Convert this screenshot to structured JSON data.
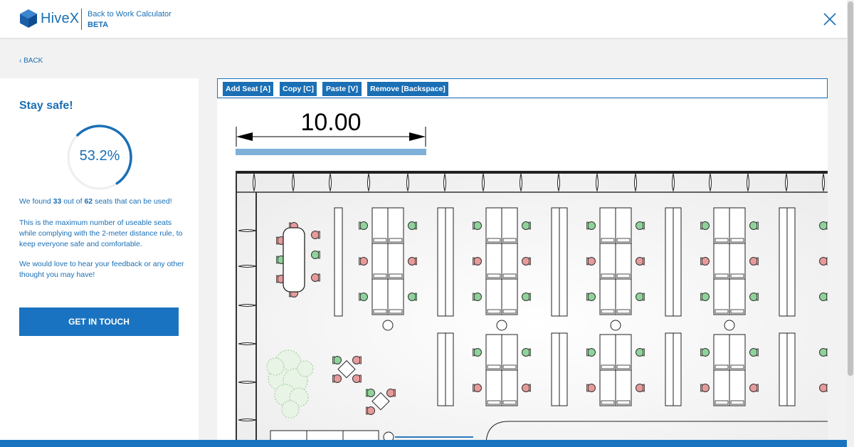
{
  "header": {
    "logo_text": "HiveX",
    "app_title": "Back to Work Calculator",
    "app_badge": "BETA",
    "close_icon": "close-icon"
  },
  "nav": {
    "back_label": "‹ BACK"
  },
  "panel": {
    "heading": "Stay safe!",
    "usage_percent": "53.2%",
    "usage_fraction": 0.532,
    "found_prefix": "We found ",
    "found_count": "33",
    "found_middle": " out of ",
    "total_count": "62",
    "found_suffix": " seats that can be used!",
    "paragraph1": "This is the maximum number of useable seats while complying with the 2-meter distance rule, to keep everyone safe and comfortable.",
    "paragraph2": "We would love to hear your feedback or any other thought you may have!",
    "cta_label": "GET IN TOUCH"
  },
  "toolbar": {
    "add_seat": "Add Seat [A]",
    "copy": "Copy [C]",
    "paste": "Paste [V]",
    "remove": "Remove [Backspace]"
  },
  "floorplan": {
    "dimension_label": "10.00",
    "seat_colors": {
      "usable": "#8fd39a",
      "blocked": "#e79a9a"
    }
  },
  "colors": {
    "accent": "#1a6fb5",
    "button": "#1a73c0",
    "bar": "#7fb0d8"
  }
}
